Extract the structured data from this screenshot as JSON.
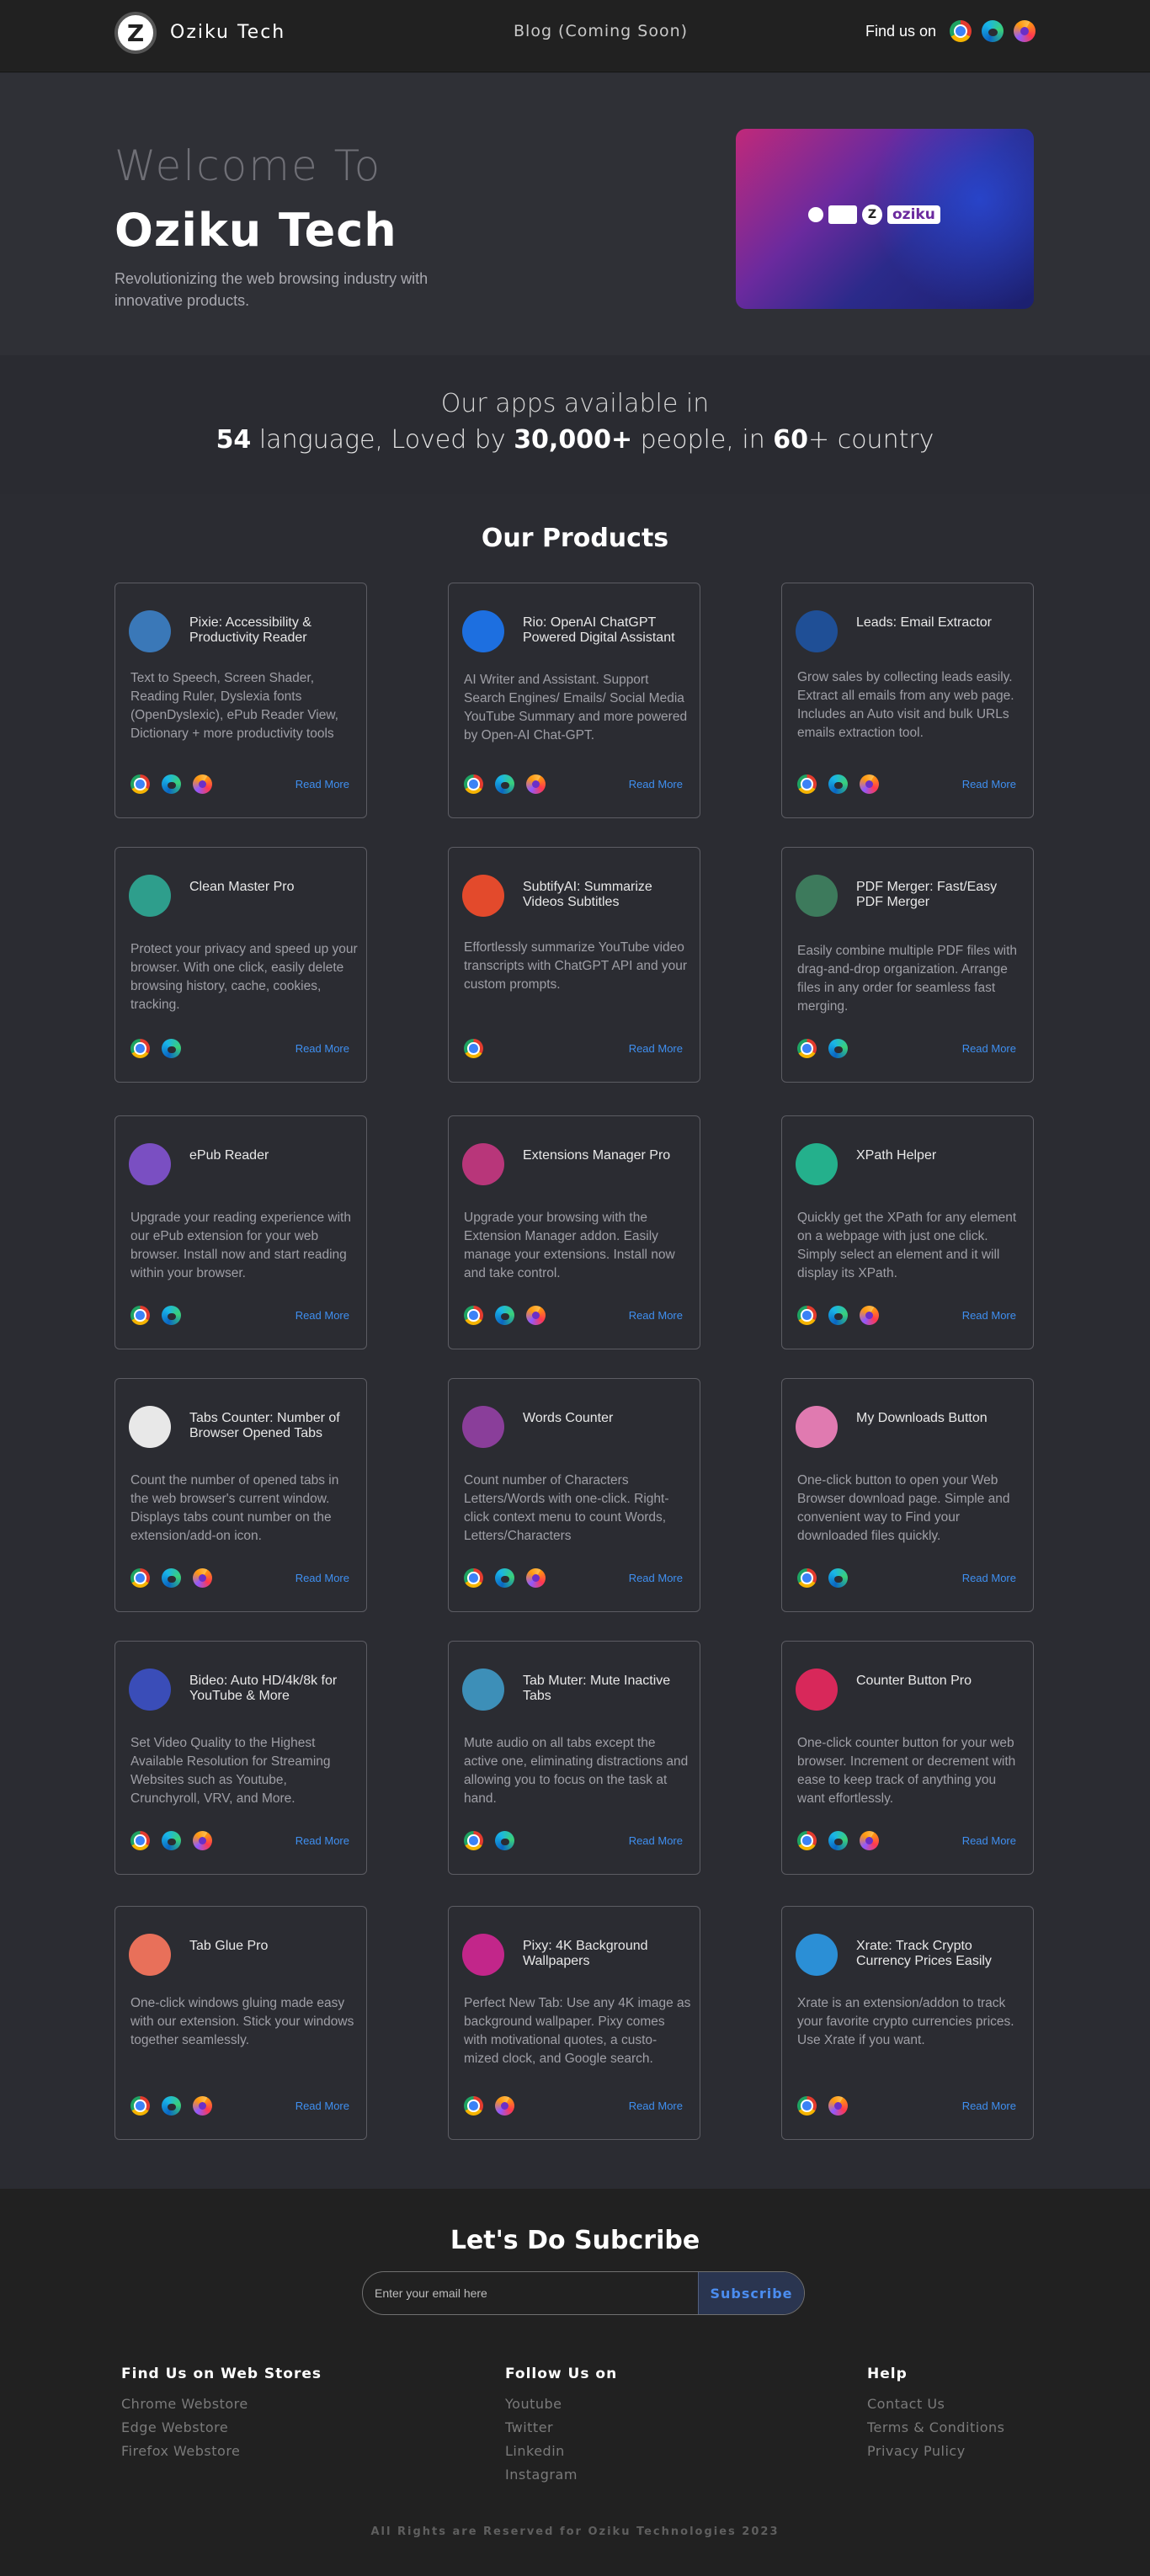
{
  "header": {
    "brand": "Oziku Tech",
    "logo_letter": "Z",
    "blog": "Blog (Coming Soon)",
    "find_us": "Find us on"
  },
  "hero": {
    "welcome": "Welcome To",
    "title": "Oziku Tech",
    "subtitle": "Revolutionizing the web browsing industry with innovative products.",
    "banner_text": "oziku"
  },
  "stats": {
    "line1": "Our apps available in",
    "languages": "54",
    "lang_text": " language, Loved by ",
    "people": "30,000+",
    "people_text": " people, in ",
    "countries": "60",
    "countries_text": "+ country"
  },
  "products_title": "Our Products",
  "read_more": "Read More",
  "products": [
    {
      "name": "Pixie: Accessibility & Productivity Reader",
      "desc": "Text to Speech, Screen Shader, Reading Ruler, Dyslexia fonts (OpenDyslexic), ePub Reader View, Dictionary + more productivity tools",
      "icon": "book-icon",
      "color": "#3a78b8",
      "browsers": [
        "chrome",
        "edge",
        "firefox"
      ]
    },
    {
      "name": "Rio: OpenAI ChatGPT Powered Digital Assistant",
      "desc": "AI Writer and Assistant. Support Search Engines/ Emails/ Social Media YouTube Summary and more powered by Open-AI Chat-GPT.",
      "icon": "r-logo-icon",
      "color": "#1d6fe0",
      "browsers": [
        "chrome",
        "edge",
        "firefox"
      ]
    },
    {
      "name": "Leads:  Email Extractor",
      "desc": "Grow sales by collecting leads easily. Extract all emails from any web page. Includes an Auto visit and bulk URLs emails extraction tool.",
      "icon": "envelope-icon",
      "color": "#1f4f96",
      "browsers": [
        "chrome",
        "edge",
        "firefox"
      ]
    },
    {
      "name": "Clean Master Pro",
      "desc": "Protect your privacy and speed up your browser. With one click, easily delete browsing history, cache, cookies, tracking.",
      "icon": "broom-icon",
      "color": "#2e9e8c",
      "browsers": [
        "chrome",
        "edge"
      ]
    },
    {
      "name": "SubtifyAI: Summarize Videos Subtitles",
      "desc": "Effortlessly summarize YouTube video transcripts with ChatGPT API and your custom prompts.",
      "icon": "chat-bubble-icon",
      "color": "#e34a2c",
      "browsers": [
        "chrome"
      ]
    },
    {
      "name": "PDF Merger: Fast/Easy PDF Merger",
      "desc": "Easily combine multiple PDF files with drag-and-drop organization. Arrange files in any order for seamless fast merging.",
      "icon": "documents-icon",
      "color": "#3d7a5c",
      "browsers": [
        "chrome",
        "edge"
      ]
    },
    {
      "name": "ePub Reader",
      "desc": "Upgrade your reading experience with our ePub extension for your web browser. Install now and start reading within your browser.",
      "icon": "epub-icon",
      "color": "#7a4fc2",
      "browsers": [
        "chrome",
        "edge"
      ]
    },
    {
      "name": "Extensions Manager Pro",
      "desc": "Upgrade your browsing with the Extension Manager addon. Easily manage your extensions. Install now and take control.",
      "icon": "toggle-icon",
      "color": "#b8367a",
      "browsers": [
        "chrome",
        "edge",
        "firefox"
      ]
    },
    {
      "name": "XPath Helper",
      "desc": "Quickly get the XPath for any element on a webpage with just one click. Simply select an element and it will display its XPath.",
      "icon": "code-icon",
      "color": "#24b08c",
      "browsers": [
        "chrome",
        "edge",
        "firefox"
      ]
    },
    {
      "name": "Tabs Counter: Number of Browser Opened Tabs",
      "desc": "Count the number of opened tabs in the web browser's current window. Displays tabs count number on the extension/add-on icon.",
      "icon": "tabs-icon",
      "color": "#e8e8e8",
      "browsers": [
        "chrome",
        "edge",
        "firefox"
      ]
    },
    {
      "name": "Words Counter",
      "desc": "Count number of Characters Letters/Words with one-click. Right-click context menu to count Words, Letters/Characters",
      "icon": "w-logo-icon",
      "color": "#8a3e9a",
      "browsers": [
        "chrome",
        "edge",
        "firefox"
      ]
    },
    {
      "name": "My Downloads Button",
      "desc": "One-click button to open your Web Browser download page. Simple and convenient way to Find your downloaded files quickly.",
      "icon": "download-icon",
      "color": "#e07ab0",
      "browsers": [
        "chrome",
        "edge"
      ]
    },
    {
      "name": "Bideo: Auto HD/4k/8k for YouTube & More",
      "desc": "Set Video Quality to the Highest Available Resolution for Streaming Websites such as Youtube, Crunchyroll, VRV, and More.",
      "icon": "hd-icon",
      "color": "#3a4db8",
      "browsers": [
        "chrome",
        "edge",
        "firefox"
      ]
    },
    {
      "name": "Tab Muter: Mute Inactive Tabs",
      "desc": "Mute audio on all tabs except the active one, eliminating distractions and allowing you to focus on the task at hand.",
      "icon": "speaker-mute-icon",
      "color": "#3d8fb8",
      "browsers": [
        "chrome",
        "edge"
      ]
    },
    {
      "name": "Counter Button Pro",
      "desc": "One-click counter button for your web browser. Increment or decrement with ease to keep track of anything you want effortlessly.",
      "icon": "stopwatch-icon",
      "color": "#d8285a",
      "browsers": [
        "chrome",
        "edge",
        "firefox"
      ]
    },
    {
      "name": "Tab Glue Pro",
      "desc": "One-click windows gluing made easy with our extension. Stick your windows together seamlessly.",
      "icon": "puzzle-icon",
      "color": "#e8705a",
      "browsers": [
        "chrome",
        "edge",
        "firefox"
      ]
    },
    {
      "name": "Pixy: 4K Background Wallpapers",
      "desc": "Perfect New Tab: Use any 4K image as background wallpaper. Pixy comes with motivational quotes, a custo-mized clock, and Google search.",
      "icon": "p-logo-icon",
      "color": "#c2268a",
      "browsers": [
        "chrome",
        "firefox"
      ]
    },
    {
      "name": "Xrate: Track Crypto Currency Prices Easily",
      "desc": "Xrate is an extension/addon to track your favorite crypto currencies prices. Use Xrate if you want.",
      "icon": "chart-arrow-icon",
      "color": "#2b8fd6",
      "browsers": [
        "chrome",
        "firefox"
      ]
    }
  ],
  "subscribe": {
    "title": "Let's Do Subcribe",
    "placeholder": "Enter your email here",
    "button": "Subscribe"
  },
  "footer": {
    "stores_title": "Find Us on Web Stores",
    "stores": [
      "Chrome Webstore",
      "Edge Webstore",
      "Firefox Webstore"
    ],
    "follow_title": "Follow Us on",
    "follow": [
      "Youtube",
      "Twitter",
      "Linkedin",
      "Instagram"
    ],
    "help_title": "Help",
    "help": [
      "Contact Us",
      "Terms & Conditions",
      "Privacy Pulicy"
    ],
    "copyright": "All Rights are Reserved for Oziku Technologies 2023"
  }
}
